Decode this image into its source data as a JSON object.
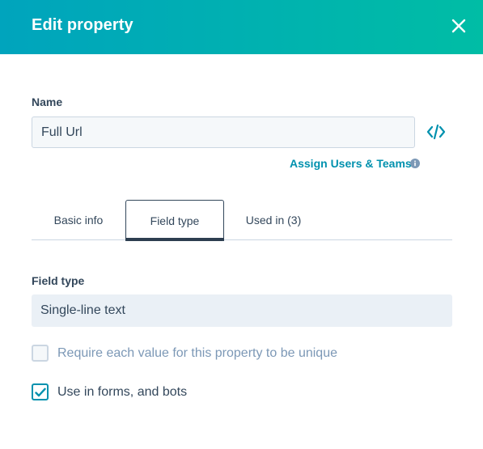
{
  "header": {
    "title": "Edit property",
    "close_icon": "close-icon",
    "gradient_start": "#00a4bd",
    "gradient_end": "#00bda5"
  },
  "name_section": {
    "label": "Name",
    "value": "Full Url",
    "code_icon": "code-icon",
    "assign_link": "Assign Users & Teams",
    "info_icon": "info-icon"
  },
  "tabs": [
    {
      "label": "Basic info",
      "active": false
    },
    {
      "label": "Field type",
      "active": true
    },
    {
      "label": "Used in (3)",
      "active": false
    }
  ],
  "field_type": {
    "label": "Field type",
    "selected": "Single-line text"
  },
  "options": {
    "unique": {
      "label": "Require each value for this property to be unique",
      "checked": false,
      "disabled": true
    },
    "forms": {
      "label": "Use in forms, and bots",
      "checked": true,
      "disabled": false
    }
  },
  "colors": {
    "accent": "#0091ae",
    "text": "#33475b",
    "muted": "#7c98b6"
  }
}
